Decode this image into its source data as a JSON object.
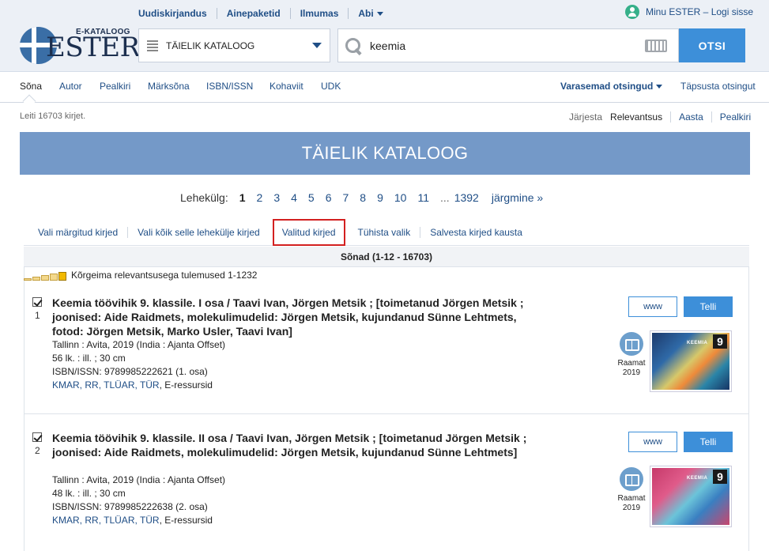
{
  "topnav": {
    "items": [
      "Uudiskirjandus",
      "Ainepaketid",
      "Ilmumas",
      "Abi"
    ],
    "user": "Minu ESTER – Logi sisse"
  },
  "logo": {
    "sub": "E-KATALOOG",
    "main": "ESTER"
  },
  "catalog_select": {
    "value": "TÄIELIK KATALOOG"
  },
  "search": {
    "value": "keemia",
    "button": "OTSI"
  },
  "tabs": {
    "items": [
      "Sõna",
      "Autor",
      "Pealkiri",
      "Märksõna",
      "ISBN/ISSN",
      "Kohaviit",
      "UDK"
    ],
    "previous": "Varasemad otsingud",
    "refine": "Täpsusta otsingut"
  },
  "results": {
    "found": "Leiti 16703 kirjet.",
    "sort_label": "Järjesta",
    "sort_options": [
      "Relevantsus",
      "Aasta",
      "Pealkiri"
    ]
  },
  "banner": {
    "title": "TÄIELIK KATALOOG"
  },
  "pager": {
    "label": "Lehekülg:",
    "pages": [
      "1",
      "2",
      "3",
      "4",
      "5",
      "6",
      "7",
      "8",
      "9",
      "10",
      "11"
    ],
    "ellipsis": "...",
    "last": "1392",
    "next": "järgmine »"
  },
  "actions": [
    "Vali märgitud kirjed",
    "Vali kõik selle lehekülje kirjed",
    "Valitud kirjed",
    "Tühista valik",
    "Salvesta kirjed kausta"
  ],
  "group": {
    "header": "Sõnad (1-12 - 16703)",
    "relevance": "Kõrgeima relevantsusega tulemused 1-1232"
  },
  "records": [
    {
      "num": "1",
      "title": "Keemia töövihik 9. klassile. I osa / Taavi Ivan, Jörgen Metsik ; [toimetanud Jörgen Metsik ; joonised: Aide Raidmets, molekulimudelid: Jörgen Metsik, kujundanud Sünne Lehtmets, fotod: Jörgen Metsik, Marko Usler, Taavi Ivan]",
      "publisher": "Tallinn : Avita, 2019 (India : Ajanta Offset)",
      "extent": "56 lk. : ill. ; 30 cm",
      "isbn": "ISBN/ISSN:  9789985222621 (1. osa)",
      "libraries": [
        "KMAR",
        "RR",
        "TLÜAR",
        "TÜR"
      ],
      "eres": "E-ressursid",
      "type": "Raamat",
      "year": "2019",
      "www": "www",
      "order": "Telli",
      "cover_title": "KEEMIA",
      "cover_num": "9"
    },
    {
      "num": "2",
      "title": "Keemia töövihik 9. klassile. II osa / Taavi Ivan, Jörgen Metsik ; [toimetanud Jörgen Metsik ; joonised: Aide Raidmets, molekulimudelid: Jörgen Metsik, kujundanud Sünne Lehtmets]",
      "publisher": "Tallinn : Avita, 2019 (India : Ajanta Offset)",
      "extent": "48 lk. : ill. ; 30 cm",
      "isbn": "ISBN/ISSN:  9789985222638 (2. osa)",
      "libraries": [
        "KMAR",
        "RR",
        "TLÜAR",
        "TÜR"
      ],
      "eres": "E-ressursid",
      "type": "Raamat",
      "year": "2019",
      "www": "www",
      "order": "Telli",
      "cover_title": "KEEMIA",
      "cover_num": "9"
    }
  ],
  "colors": {
    "brand": "#1f4e86",
    "accent": "#3d8fd9",
    "banner": "#7499c8",
    "highlight": "#d32020"
  },
  "icons": [
    "user-icon",
    "list-icon",
    "search-icon",
    "keyboard-icon",
    "chevron-down-icon",
    "book-icon",
    "checkbox-icon"
  ]
}
